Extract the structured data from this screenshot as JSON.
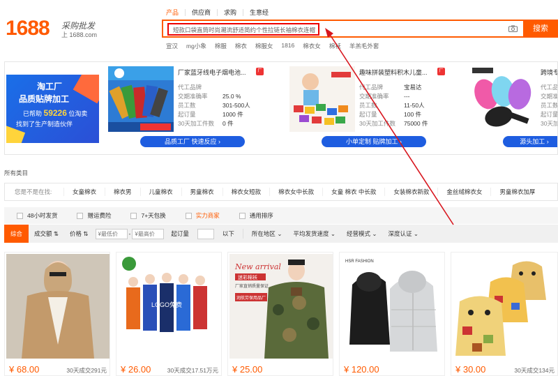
{
  "header": {
    "logo_number": "1688",
    "logo_text": "采购批发",
    "logo_site": "上 1688.com",
    "search_tabs": [
      "产品",
      "供应商",
      "求购",
      "生意经"
    ],
    "search_query": "短款口袋直筒时尚潮流舒适简约个性拉链长袖棉衣连帽",
    "search_button": "搜索",
    "hot_words": [
      "宣汉",
      "mg小象",
      "棉服",
      "棉衣",
      "棉服女",
      "1816",
      "棉衣女",
      "棉袄",
      "羊羔毛外套"
    ]
  },
  "banner": {
    "ad": {
      "line1": "淘工厂",
      "line2": "品质贴牌加工",
      "line3_prefix": "已帮助",
      "line3_number": "59226",
      "line3_suffix": "位淘卖",
      "line4": "找到了生产制造伙伴"
    },
    "factories": [
      {
        "title": "厂家蓝牙线电子烟电池...",
        "rows": [
          {
            "k": "代工品牌",
            "v": ""
          },
          {
            "k": "交期准确率",
            "v": "25.0 %"
          },
          {
            "k": "员工数",
            "v": "301-500人"
          },
          {
            "k": "起订量",
            "v": "1000 件"
          },
          {
            "k": "30天加工件数",
            "v": "0 件"
          }
        ],
        "button": "品质工厂  快速反应  ›"
      },
      {
        "title": "趣味拼装塑料积木儿童...",
        "rows": [
          {
            "k": "代工品牌",
            "v": "宝易达"
          },
          {
            "k": "交期准确率",
            "v": "---"
          },
          {
            "k": "员工数",
            "v": "11-50人"
          },
          {
            "k": "起订量",
            "v": "100 件"
          },
          {
            "k": "30天加工件数",
            "v": "75000 件"
          }
        ],
        "button": "小单定制  贴牌加工  ›"
      },
      {
        "title": "跨境专",
        "rows": [
          {
            "k": "代工品",
            "v": ""
          },
          {
            "k": "交期准",
            "v": ""
          },
          {
            "k": "员工数",
            "v": ""
          },
          {
            "k": "起订量",
            "v": ""
          },
          {
            "k": "30天加",
            "v": ""
          }
        ],
        "button": "源头加工  ›"
      }
    ]
  },
  "categories": {
    "all_label": "所有类目",
    "searching_label": "您是不是在找:",
    "items": [
      "女童棉衣",
      "棉衣男",
      "儿童棉衣",
      "男童棉衣",
      "棉衣女短款",
      "棉衣女中长款",
      "女童 棉衣 中长款",
      "女装棉衣新款",
      "金丝绒棉衣女",
      "男童棉衣加厚"
    ]
  },
  "filters": {
    "checkboxes": [
      {
        "label": "48小时发货",
        "highlight": false
      },
      {
        "label": "赠运费险",
        "highlight": false
      },
      {
        "label": "7+天包换",
        "highlight": false
      },
      {
        "label": "实力商家",
        "highlight": true
      },
      {
        "label": "通用排序",
        "highlight": false
      }
    ]
  },
  "sort": {
    "default": "综合",
    "volume": "成交额",
    "price": "价格",
    "min_price_placeholder": "¥最低价",
    "dash": "-",
    "max_price_placeholder": "¥最高价",
    "min_order": "起订量",
    "below": "以下",
    "location": "所在地区",
    "ship_speed": "平均发货速度",
    "business_mode": "经营模式",
    "depth_cert": "深度认证"
  },
  "products": [
    {
      "price": "¥ 68.00",
      "sold": "30天成交291元"
    },
    {
      "price": "¥ 26.00",
      "sold": "30天成交17.51万元"
    },
    {
      "price": "¥ 25.00",
      "sold": ""
    },
    {
      "price": "¥ 120.00",
      "sold": ""
    },
    {
      "price": "¥ 30.00",
      "sold": "30天成交134元"
    }
  ],
  "product_image_text": {
    "p2_logo": "LOGO免费",
    "p3_new": "New arrival",
    "p3_brand": "迷彩棉袄",
    "p3_sub1": "厂家直销",
    "p3_sub2": "质量保证",
    "p3_factory": "润航劳保用品厂",
    "p4_brand": "HSR FASHION"
  },
  "colors": {
    "brand_orange": "#ff5a00",
    "highlight_red": "#e00000",
    "factory_button_blue": "#1e5de0"
  }
}
